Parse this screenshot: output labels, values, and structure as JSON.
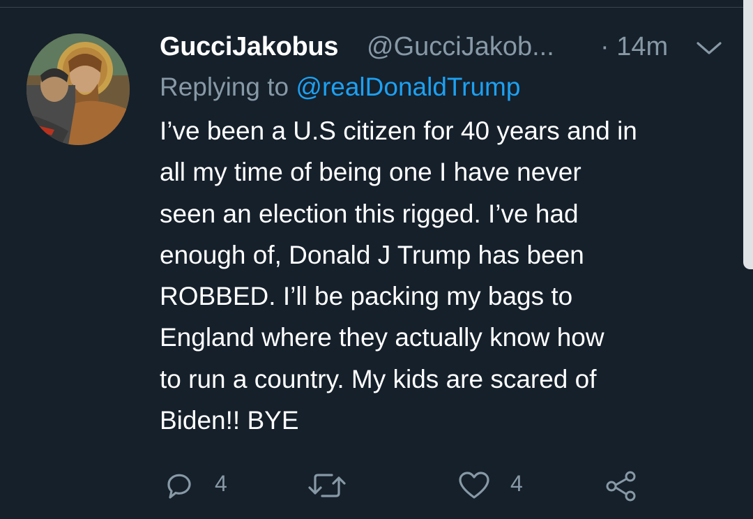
{
  "tweet": {
    "display_name": "GucciJakobus",
    "handle": "@GucciJakob...",
    "time": "· 14m",
    "reply_prefix": "Replying to",
    "reply_mention": "@realDonaldTrump",
    "body_lines": [
      "I’ve been a U.S citizen for 40 years and in",
      "all my time of being one I have never",
      "seen an election this rigged. I’ve had",
      "enough of, Donald J Trump has been",
      "ROBBED. I’ll be packing my bags to",
      "England where they actually know how",
      "to run a country. My kids are scared of",
      "Biden!! BYE"
    ]
  },
  "actions": {
    "reply_count": "4",
    "retweet_count": "",
    "like_count": "4"
  },
  "icons": {
    "reply": "reply-icon",
    "retweet": "retweet-icon",
    "like": "like-icon",
    "share": "share-icon",
    "caret": "chevron-down-icon"
  },
  "colors": {
    "background": "#15202b",
    "text_primary": "#ffffff",
    "text_secondary": "#8899a6",
    "link": "#1da1f2",
    "divider": "#38444d"
  }
}
